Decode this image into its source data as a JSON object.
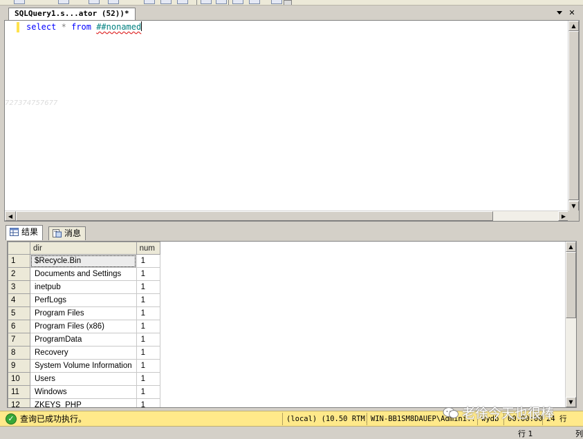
{
  "editor_tab": {
    "title": "SQLQuery1.s...ator (52))*",
    "dropdown_icon": "chevron-down-icon",
    "close_icon": "close-icon",
    "close_glyph": "✕"
  },
  "editor": {
    "code": {
      "keyword_select": "select",
      "star": "*",
      "keyword_from": "from",
      "table": "##nonamed"
    },
    "faint_text": "727374757677"
  },
  "results_tabs": [
    {
      "label": "结果",
      "icon": "grid-icon"
    },
    {
      "label": "消息",
      "icon": "message-icon"
    }
  ],
  "grid": {
    "columns": [
      "dir",
      "num"
    ],
    "rows": [
      {
        "n": "1",
        "dir": "$Recycle.Bin",
        "num": "1"
      },
      {
        "n": "2",
        "dir": "Documents and Settings",
        "num": "1"
      },
      {
        "n": "3",
        "dir": "inetpub",
        "num": "1"
      },
      {
        "n": "4",
        "dir": "PerfLogs",
        "num": "1"
      },
      {
        "n": "5",
        "dir": "Program Files",
        "num": "1"
      },
      {
        "n": "6",
        "dir": "Program Files (x86)",
        "num": "1"
      },
      {
        "n": "7",
        "dir": "ProgramData",
        "num": "1"
      },
      {
        "n": "8",
        "dir": "Recovery",
        "num": "1"
      },
      {
        "n": "9",
        "dir": "System Volume Information",
        "num": "1"
      },
      {
        "n": "10",
        "dir": "Users",
        "num": "1"
      },
      {
        "n": "11",
        "dir": "Windows",
        "num": "1"
      },
      {
        "n": "12",
        "dir": "ZKEYS_PHP",
        "num": "1"
      }
    ]
  },
  "status": {
    "icon": "check-circle-icon",
    "message": "查询已成功执行。",
    "server": "(local) (10.50 RTM)",
    "user": "WIN-BB1SM8DAUEP\\Admini...",
    "database": "wydb",
    "elapsed": "00:00:00",
    "row_count": "24 行"
  },
  "watermark": {
    "text": "老徐今天也很棒",
    "icon": "wechat-icon"
  },
  "app_status": {
    "line": "行 1",
    "col": "列"
  },
  "colors": {
    "status_bg": "#ffe98a",
    "keyword": "#0000ff",
    "table_ref": "#008080"
  }
}
